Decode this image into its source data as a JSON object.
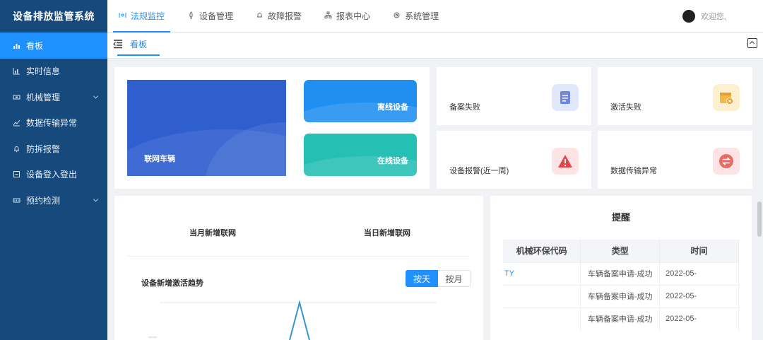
{
  "brand": "设备排放监管系统",
  "sidebar": {
    "items": [
      {
        "label": "看板",
        "icon": "chart-icon",
        "active": true
      },
      {
        "label": "实时信息",
        "icon": "bar-chart-icon"
      },
      {
        "label": "机械管理",
        "icon": "machine-icon",
        "expandable": true
      },
      {
        "label": "数据传输异常",
        "icon": "trend-icon"
      },
      {
        "label": "防拆报警",
        "icon": "bell-icon"
      },
      {
        "label": "设备登入登出",
        "icon": "login-icon"
      },
      {
        "label": "预约检测",
        "icon": "schedule-icon",
        "expandable": true
      }
    ]
  },
  "topnav": {
    "items": [
      {
        "label": "法规监控",
        "active": true
      },
      {
        "label": "设备管理"
      },
      {
        "label": "故障报警"
      },
      {
        "label": "报表中心"
      },
      {
        "label": "系统管理"
      }
    ],
    "welcome": "欢迎您,"
  },
  "tabs": [
    {
      "label": "看板"
    }
  ],
  "dashboard": {
    "connected": "联网车辆",
    "offline": "离线设备",
    "online": "在线设备",
    "filing_fail": "备案失败",
    "activation_fail": "激活失败",
    "device_alarm": "设备报警(近一周)",
    "transfer_error": "数据传输异常"
  },
  "trend": {
    "month_new": "当月新增联网",
    "day_new": "当日新增联网",
    "title": "设备新增激活趋势",
    "by_day": "按天",
    "by_month": "按月"
  },
  "reminder": {
    "title": "提醒",
    "columns": [
      "机械环保代码",
      "类型",
      "时间"
    ],
    "rows": [
      {
        "code": "TY",
        "type": "车辆备案申请-成功",
        "time": "2022-05-"
      },
      {
        "code": "",
        "type": "车辆备案申请-成功",
        "time": "2022-05-"
      },
      {
        "code": "",
        "type": "车辆备案申请-成功",
        "time": "2022-05-"
      }
    ]
  },
  "colors": {
    "sidebar_bg": "#174a7c",
    "accent": "#1e90ff",
    "offline_card": "#1f8ff0",
    "online_card": "#25bfb3",
    "connected_card": "#2f5fcf"
  }
}
